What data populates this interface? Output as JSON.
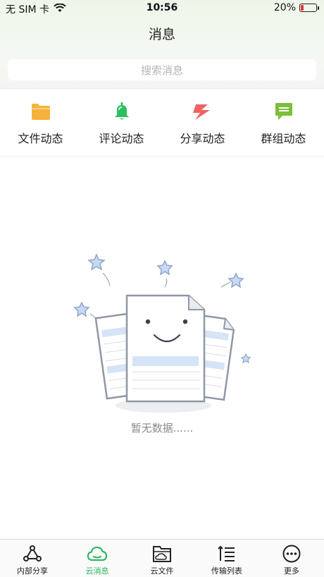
{
  "status_bar": {
    "carrier": "无 SIM 卡",
    "time": "10:56",
    "battery_percent": "20%",
    "battery_level": 0.2,
    "wifi_icon": "wifi-icon"
  },
  "header": {
    "title": "消息"
  },
  "search": {
    "placeholder": "搜索消息"
  },
  "categories": [
    {
      "label": "文件动态",
      "icon": "folder-icon",
      "color": "#f5b13d"
    },
    {
      "label": "评论动态",
      "icon": "bell-icon",
      "color": "#2fbf5f"
    },
    {
      "label": "分享动态",
      "icon": "lightning-icon",
      "color": "#f06262"
    },
    {
      "label": "群组动态",
      "icon": "chat-icon",
      "color": "#7bbf3a"
    }
  ],
  "empty_state": {
    "text": "暂无数据......",
    "illustration": "empty-documents-illustration"
  },
  "tabbar": [
    {
      "label": "内部分享",
      "icon": "share-network-icon",
      "active": false
    },
    {
      "label": "云消息",
      "icon": "cloud-icon",
      "active": true
    },
    {
      "label": "云文件",
      "icon": "cloud-folder-icon",
      "active": false
    },
    {
      "label": "传输列表",
      "icon": "list-icon",
      "active": false
    },
    {
      "label": "更多",
      "icon": "more-icon",
      "active": false
    }
  ],
  "colors": {
    "accent": "#26b35a",
    "battery_low": "#e53935"
  }
}
